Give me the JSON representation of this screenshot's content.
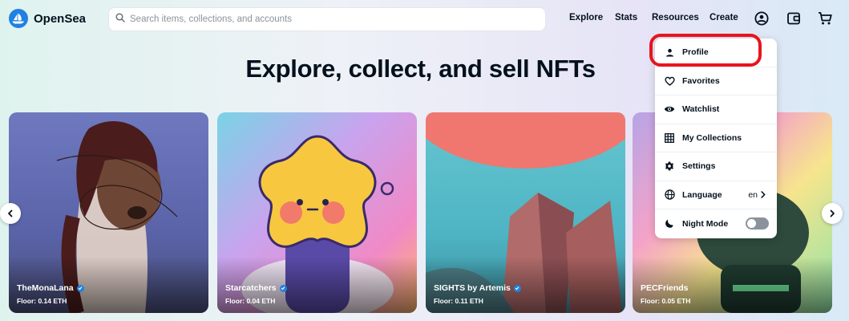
{
  "header": {
    "brand": "OpenSea",
    "search": {
      "placeholder": "Search items, collections, and accounts",
      "value": ""
    },
    "nav": [
      "Explore",
      "Stats",
      "Resources",
      "Create"
    ],
    "icons": [
      "account-circle-icon",
      "wallet-icon",
      "cart-icon"
    ]
  },
  "hero": {
    "title": "Explore, collect, and sell NFTs"
  },
  "cards": [
    {
      "name": "TheMonaLana",
      "floor": "Floor: 0.14 ETH",
      "verified": true
    },
    {
      "name": "Starcatchers",
      "floor": "Floor: 0.04 ETH",
      "verified": true
    },
    {
      "name": "SIGHTS by Artemis",
      "floor": "Floor: 0.11 ETH",
      "verified": true
    },
    {
      "name": "PECFriends",
      "floor": "Floor: 0.05 ETH",
      "verified": false
    }
  ],
  "menu": {
    "items": [
      {
        "label": "Profile",
        "icon": "person-icon"
      },
      {
        "label": "Favorites",
        "icon": "heart-icon"
      },
      {
        "label": "Watchlist",
        "icon": "eye-icon"
      },
      {
        "label": "My Collections",
        "icon": "grid-icon"
      },
      {
        "label": "Settings",
        "icon": "gear-icon"
      },
      {
        "label": "Language",
        "icon": "globe-icon",
        "value": "en"
      },
      {
        "label": "Night Mode",
        "icon": "moon-icon",
        "toggle": false
      }
    ]
  },
  "colors": {
    "brand": "#2081e2",
    "highlight": "#e8141c",
    "text": "#04111d"
  }
}
